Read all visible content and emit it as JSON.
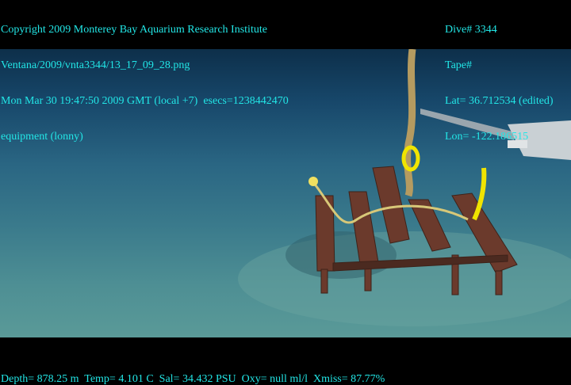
{
  "header_left": {
    "line1": "Copyright 2009 Monterey Bay Aquarium Research Institute",
    "line2": "Ventana/2009/vnta3344/13_17_09_28.png",
    "line3": "Mon Mar 30 19:47:50 2009 GMT (local +7)  esecs=1238442470",
    "line4": "equipment (lonny)"
  },
  "header_right": {
    "dive": "Dive# 3344",
    "tape": "Tape#",
    "lat": "Lat= 36.712534 (edited)",
    "lon": "Lon= -122.186515"
  },
  "footer": {
    "sensors": "Depth= 878.25 m  Temp= 4.101 C  Sal= 34.432 PSU  Oxy= null ml/l  Xmiss= 87.77%"
  },
  "colors": {
    "overlay_text": "#22e6e6",
    "rope_marker": "#f0e400"
  }
}
